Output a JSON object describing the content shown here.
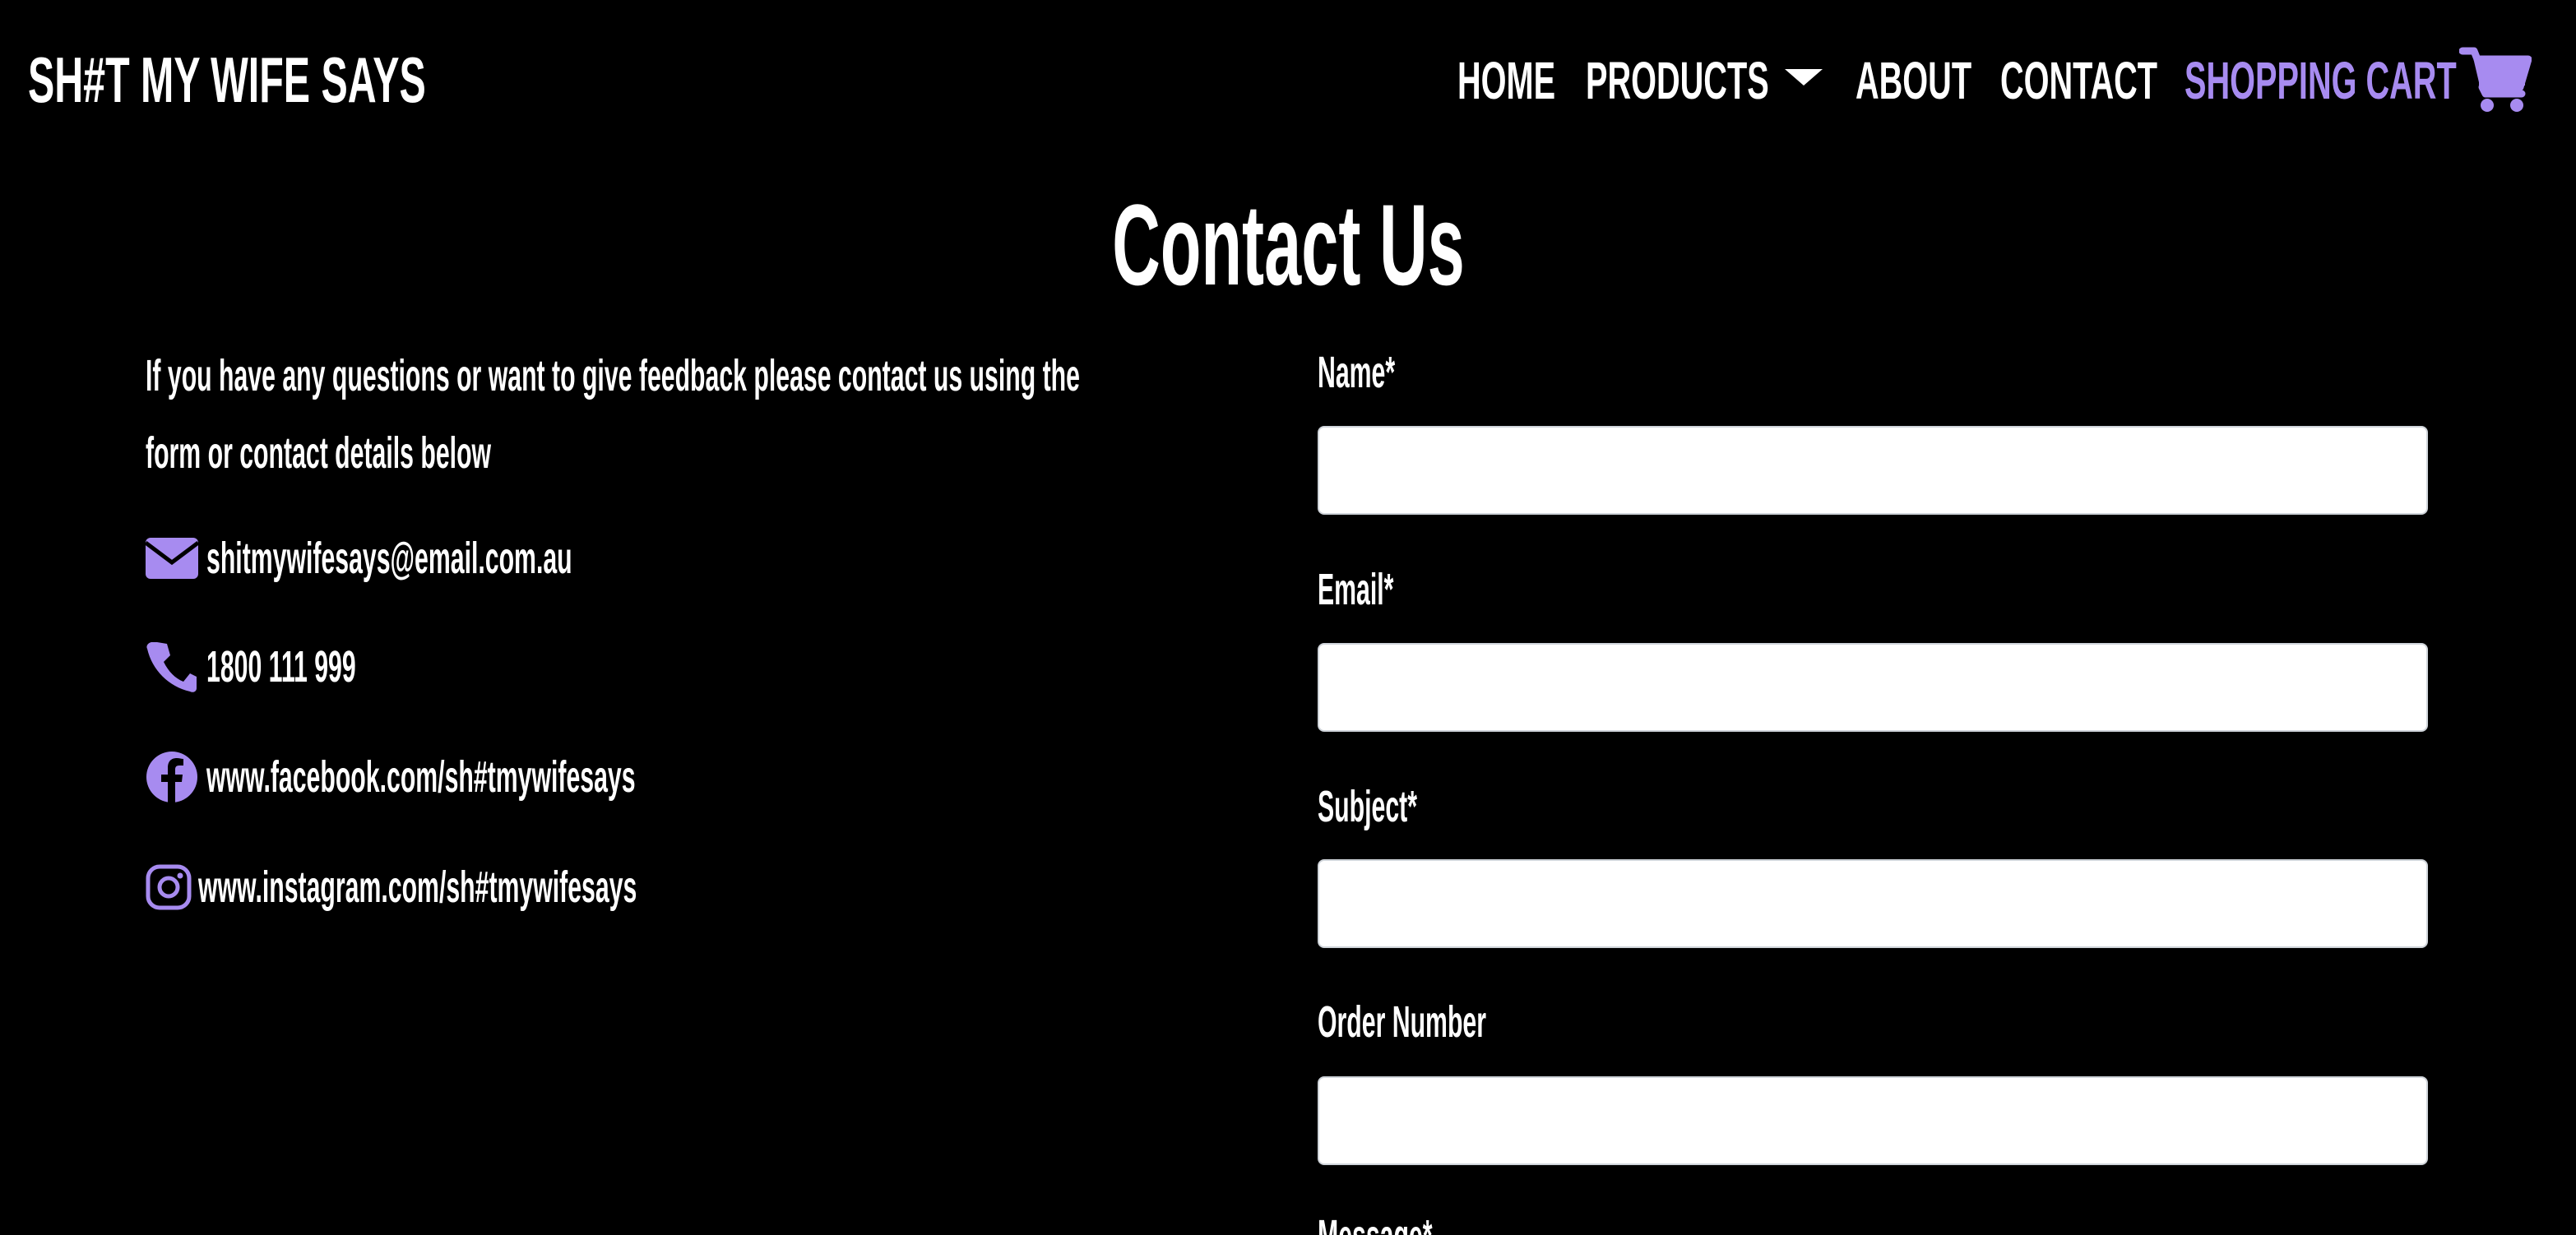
{
  "header": {
    "brand": "SH#T MY WIFE SAYS",
    "nav": {
      "home": "HOME",
      "products": "PRODUCTS",
      "about": "ABOUT",
      "contact": "CONTACT",
      "cart": "SHOPPING CART"
    }
  },
  "main": {
    "title": "Contact Us",
    "intro_line1": "If you have any questions or want to give feedback please contact us using the",
    "intro_line2": "form or contact details below",
    "contacts": {
      "email": "shitmywifesays@email.com.au",
      "phone": "1800 111 999",
      "facebook": "www.facebook.com/sh#tmywifesays",
      "instagram": "www.instagram.com/sh#tmywifesays"
    }
  },
  "form": {
    "name_label": "Name*",
    "email_label": "Email*",
    "subject_label": "Subject*",
    "order_label": "Order Number",
    "message_label": "Message*",
    "name_value": "",
    "email_value": "",
    "subject_value": "",
    "order_value": ""
  },
  "colors": {
    "background": "#000000",
    "text": "#ffffff",
    "accent": "#a78bf0"
  },
  "icons": {
    "email": "envelope-icon",
    "phone": "phone-icon",
    "facebook": "facebook-icon",
    "instagram": "instagram-icon",
    "cart": "shopping-cart-icon",
    "dropdown": "caret-down-icon"
  }
}
